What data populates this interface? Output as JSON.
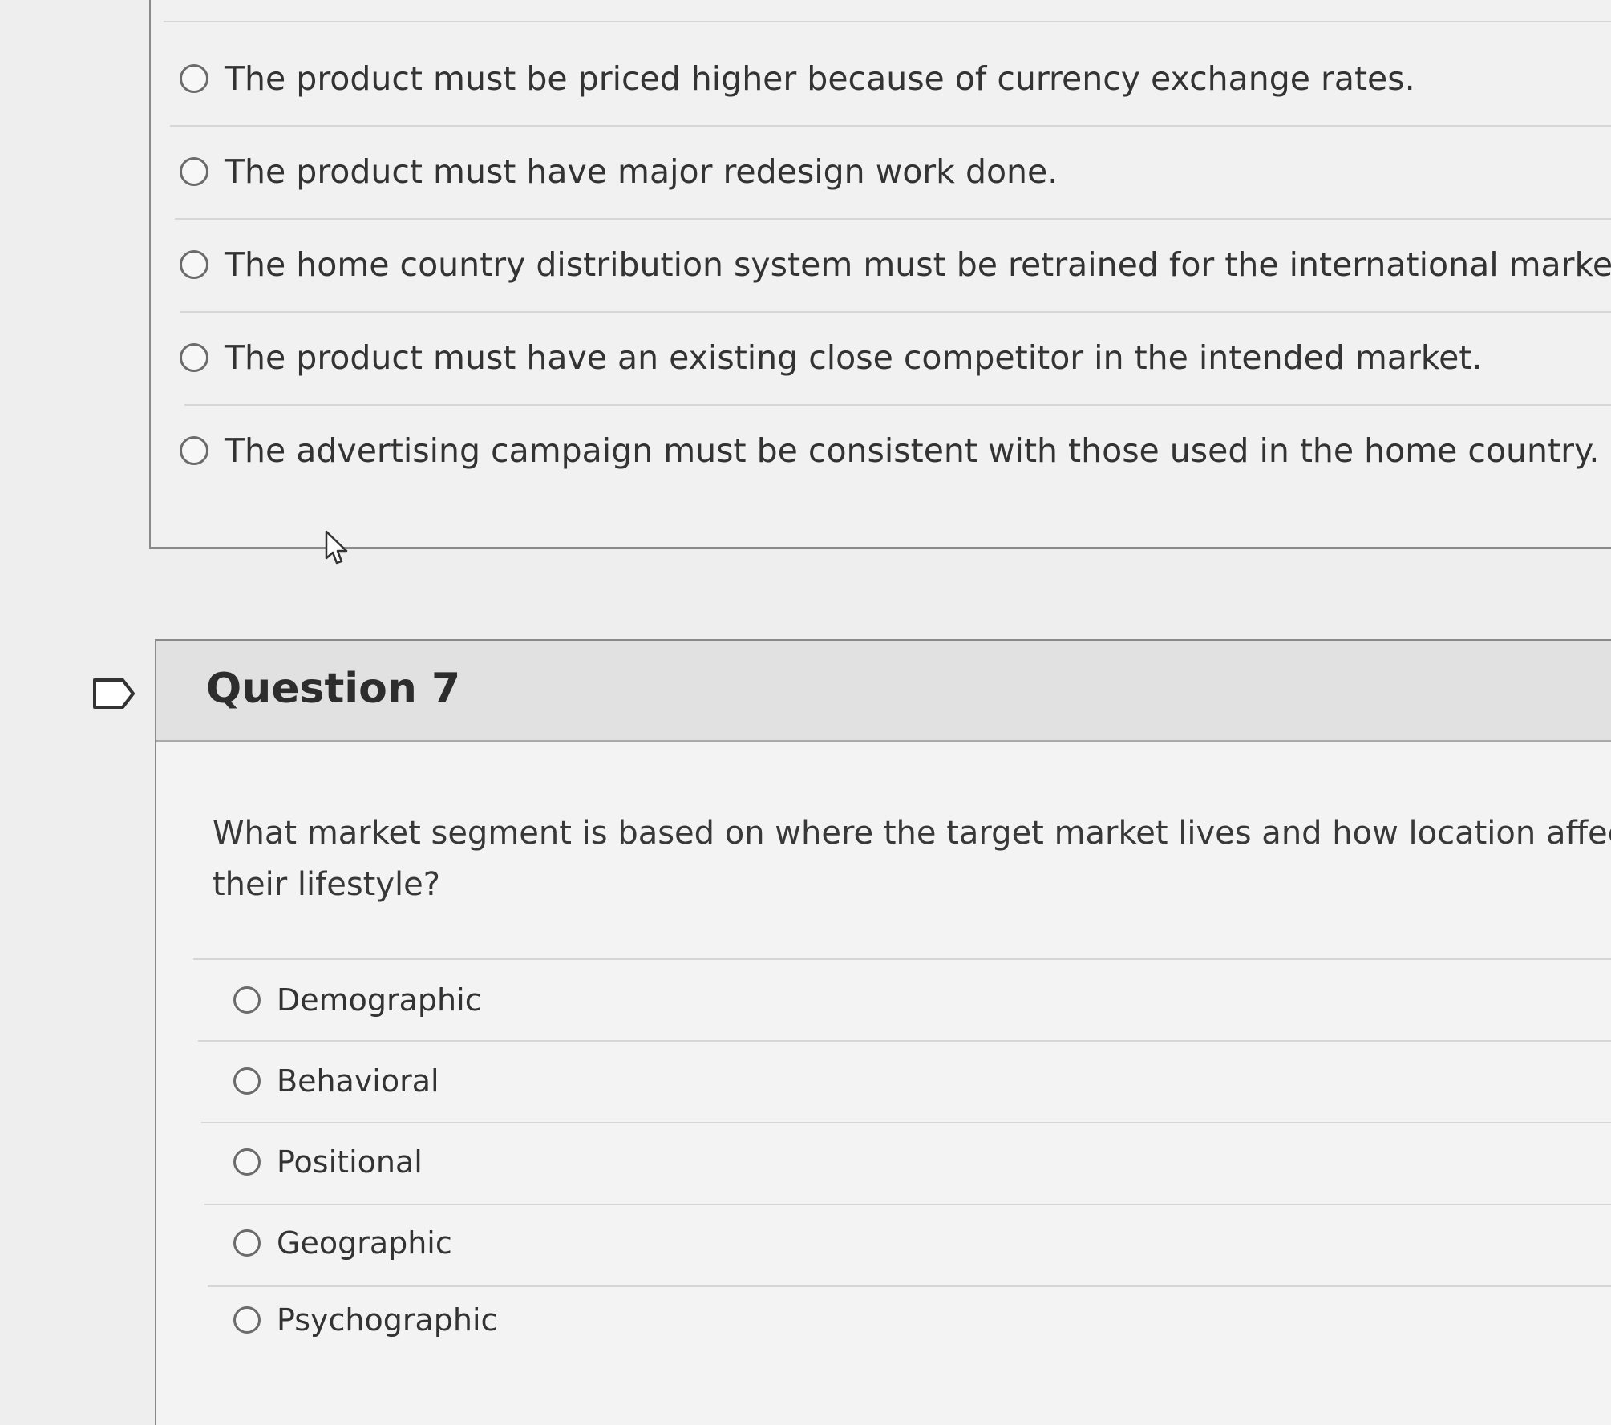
{
  "prev_question": {
    "options": [
      "The product must be priced higher because of currency exchange rates.",
      "The product must have major redesign work done.",
      "The home country distribution system must be retrained for the international market.",
      "The product must have an existing close competitor in the intended market.",
      "The advertising campaign must be consistent with those used in the home country."
    ]
  },
  "question7": {
    "title": "Question 7",
    "text": "What market segment is based on where the target market lives and how location affects their lifestyle?",
    "options": [
      "Demographic",
      "Behavioral",
      "Positional",
      "Geographic",
      "Psychographic"
    ]
  },
  "icons": {
    "flag": "flag-icon",
    "radio": "radio-unselected-icon",
    "cursor": "mouse-pointer-icon"
  },
  "colors": {
    "page_background": "#eeeeee",
    "header_background": "#e1e1e1",
    "text": "#333333",
    "radio_border": "#6b6b6b"
  }
}
